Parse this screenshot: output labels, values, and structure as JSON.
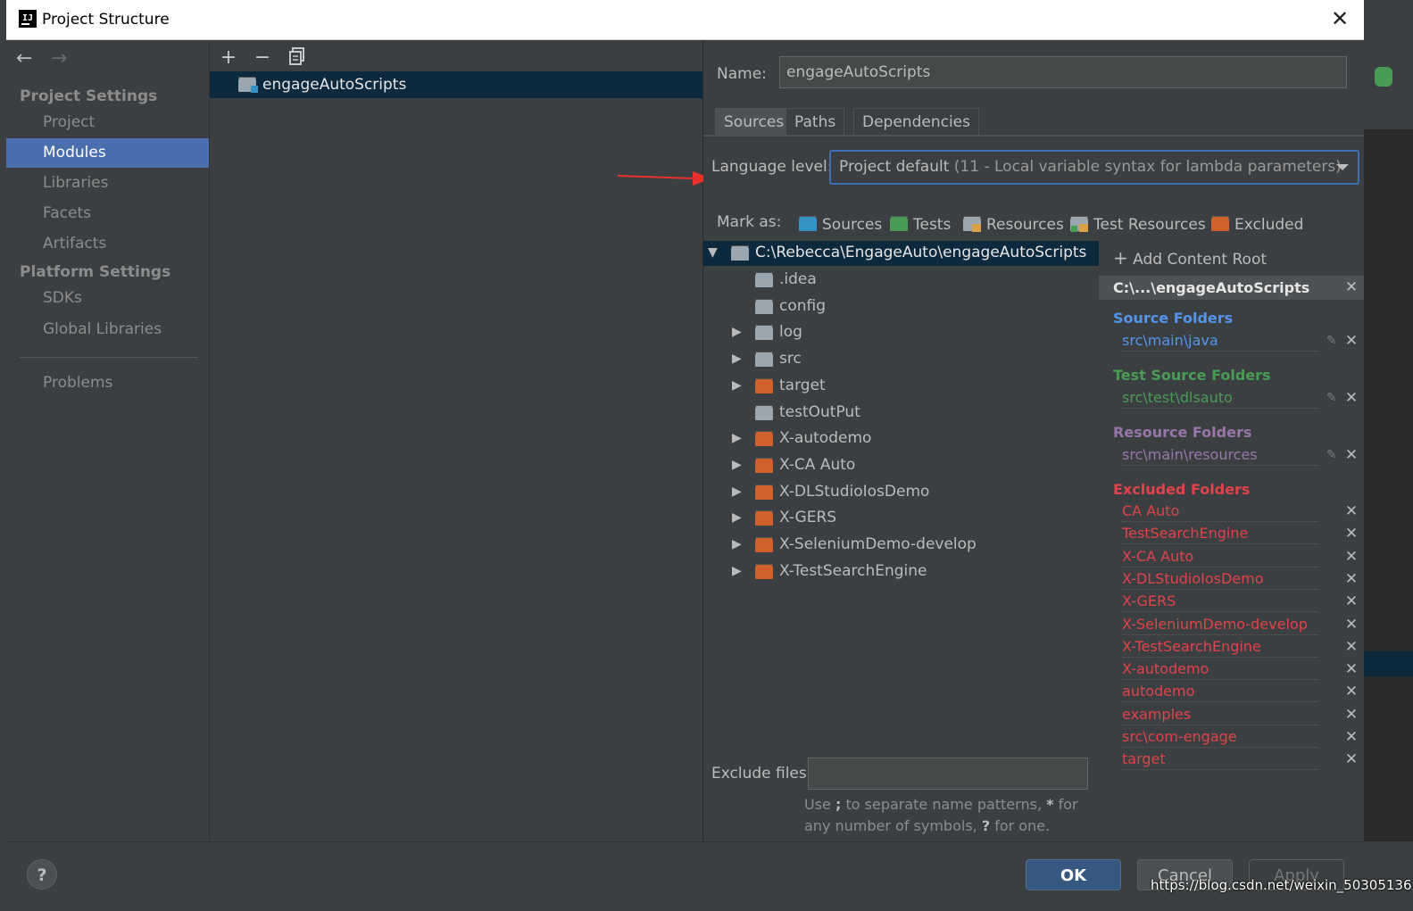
{
  "window": {
    "title": "Project Structure"
  },
  "sidebar": {
    "section1_label": "Project Settings",
    "section2_label": "Platform Settings",
    "items": [
      {
        "label": "Project"
      },
      {
        "label": "Modules",
        "selected": true
      },
      {
        "label": "Libraries"
      },
      {
        "label": "Facets"
      },
      {
        "label": "Artifacts"
      },
      {
        "label": "SDKs"
      },
      {
        "label": "Global Libraries"
      },
      {
        "label": "Problems"
      }
    ]
  },
  "modules": {
    "toolbar_icons": [
      "plus-icon",
      "minus-icon",
      "copy-icon"
    ],
    "selected": "engageAutoScripts"
  },
  "detail": {
    "name_label": "Name:",
    "name_value": "engageAutoScripts",
    "tabs": [
      "Sources",
      "Paths",
      "Dependencies"
    ],
    "active_tab": "Sources",
    "language_level_label": "Language level:",
    "language_level_value": "Project default",
    "language_level_hint": "(11 - Local variable syntax for lambda parameters)",
    "mark_as_label": "Mark as:",
    "mark_as": [
      {
        "label": "Sources",
        "color": "#3592c4"
      },
      {
        "label": "Tests",
        "color": "#499c54"
      },
      {
        "label": "Resources",
        "color": "#9aa7b0"
      },
      {
        "label": "Test Resources",
        "color": "#9aa7b0"
      },
      {
        "label": "Excluded",
        "color": "#d0602c"
      }
    ],
    "tree": {
      "root": "C:\\Rebecca\\EngageAuto\\engageAutoScripts",
      "children": [
        {
          "name": ".idea",
          "expandable": false,
          "excluded": false
        },
        {
          "name": "config",
          "expandable": false,
          "excluded": false
        },
        {
          "name": "log",
          "expandable": true,
          "excluded": false
        },
        {
          "name": "src",
          "expandable": true,
          "excluded": false
        },
        {
          "name": "target",
          "expandable": true,
          "excluded": true
        },
        {
          "name": "testOutPut",
          "expandable": false,
          "excluded": false
        },
        {
          "name": "X-autodemo",
          "expandable": true,
          "excluded": true
        },
        {
          "name": "X-CA Auto",
          "expandable": true,
          "excluded": true
        },
        {
          "name": "X-DLStudioIosDemo",
          "expandable": true,
          "excluded": true
        },
        {
          "name": "X-GERS",
          "expandable": true,
          "excluded": true
        },
        {
          "name": "X-SeleniumDemo-develop",
          "expandable": true,
          "excluded": true
        },
        {
          "name": "X-TestSearchEngine",
          "expandable": true,
          "excluded": true
        }
      ]
    },
    "exclude_files_label": "Exclude files:",
    "exclude_files_value": "",
    "exclude_hint_1": "Use",
    "exclude_hint_semicolon": ";",
    "exclude_hint_2": "to separate name patterns,",
    "exclude_hint_star": "*",
    "exclude_hint_3": "for any number of symbols,",
    "exclude_hint_q": "?",
    "exclude_hint_4": "for one."
  },
  "content_roots": {
    "add_label": "Add Content Root",
    "root_label": "C:\\...\\engageAutoScripts",
    "source_folders_label": "Source Folders",
    "source_folders": [
      "src\\main\\java"
    ],
    "test_source_folders_label": "Test Source Folders",
    "test_source_folders": [
      "src\\test\\dlsauto"
    ],
    "resource_folders_label": "Resource Folders",
    "resource_folders": [
      "src\\main\\resources"
    ],
    "excluded_folders_label": "Excluded Folders",
    "excluded_folders": [
      "CA Auto",
      "TestSearchEngine",
      "X-CA Auto",
      "X-DLStudioIosDemo",
      "X-GERS",
      "X-SeleniumDemo-develop",
      "X-TestSearchEngine",
      "X-autodemo",
      "autodemo",
      "examples",
      "src\\com-engage",
      "target"
    ],
    "colors": {
      "source": "#5394ec",
      "test": "#499c54",
      "resource": "#9876aa",
      "excluded": "#e0434a"
    }
  },
  "footer": {
    "ok_label": "OK",
    "cancel_label": "Cancel",
    "apply_label": "Apply",
    "watermark": "https://blog.csdn.net/weixin_50305136"
  }
}
